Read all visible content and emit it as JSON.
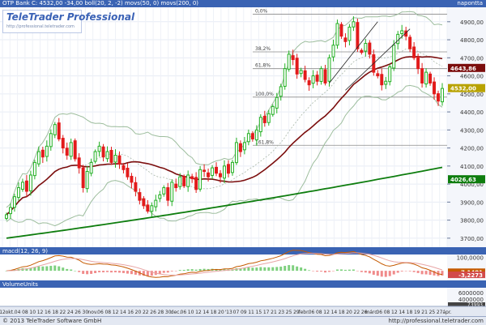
{
  "header": {
    "instrument": "OTP Bank C: 4532,00 -34,00 boll(20, 2, -2) movs(50, 0) movs(200, 0)",
    "timeframe": "napontta"
  },
  "logo": {
    "title": "TeleTrader Professional",
    "url": "http://professional.teletrader.com"
  },
  "macd_panel": {
    "title": "macd(12, 26, 9)"
  },
  "volume_panel": {
    "title": "VolumeUnits"
  },
  "footer": {
    "copyright": "© 2013 TeleTrader Software GmbH",
    "site": "http://professional.teletrader.com"
  },
  "colors": {
    "header_bg": "#3a63b3",
    "up_candle": "#22b022",
    "down_candle": "#e21b1b",
    "bollinger": "#9dbd9d",
    "ma50": "#7b0d0d",
    "ma200": "#0e7d0e",
    "macd_line": "#c55a00",
    "macd_signal": "#e8a5a5",
    "hist_pos": "#7fd07f",
    "hist_neg": "#f08a8a"
  },
  "chart_data": [
    {
      "type": "line",
      "title": "OTP Bank",
      "y_ticks": [
        "4900,00",
        "4800,00",
        "4700,00",
        "4600,00",
        "4500,00",
        "4400,00",
        "4300,00",
        "4200,00",
        "4100,00",
        "4000,00",
        "3900,00",
        "3800,00",
        "3700,00"
      ],
      "ylim": [
        3650,
        4980
      ],
      "x_ticks": [
        "12",
        "okt.",
        "04",
        "08",
        "10",
        "12",
        "16",
        "18",
        "22",
        "24",
        "26",
        "30",
        "nov.",
        "06",
        "08",
        "12",
        "14",
        "16",
        "20",
        "22",
        "26",
        "28",
        "30",
        "dec.",
        "06",
        "10",
        "12",
        "14",
        "18",
        "20",
        "'13",
        "07",
        "09",
        "11",
        "15",
        "17",
        "21",
        "23",
        "25",
        "29",
        "febr.",
        "06",
        "08",
        "12",
        "14",
        "18",
        "20",
        "22",
        "26",
        "márc.",
        "06",
        "08",
        "12",
        "14",
        "18",
        "19",
        "21",
        "25",
        "27",
        "ápr."
      ],
      "price_close": [
        3830,
        3870,
        3930,
        3980,
        4010,
        3960,
        4050,
        4120,
        4180,
        4150,
        4210,
        4280,
        4330,
        4250,
        4200,
        4160,
        4230,
        4140,
        4090,
        3980,
        4070,
        4120,
        4180,
        4210,
        4150,
        4180,
        4120,
        4160,
        4110,
        4080,
        4040,
        4010,
        3960,
        3910,
        3880,
        3850,
        3880,
        3910,
        3940,
        3980,
        3910,
        4010,
        3980,
        4040,
        3990,
        4050,
        4030,
        3970,
        4080,
        4070,
        4040,
        4090,
        4060,
        4040,
        4100,
        4060,
        4120,
        4230,
        4180,
        4230,
        4280,
        4250,
        4300,
        4370,
        4340,
        4390,
        4430,
        4480,
        4540,
        4640,
        4720,
        4690,
        4610,
        4630,
        4580,
        4550,
        4600,
        4570,
        4640,
        4560,
        4700,
        4770,
        4890,
        4820,
        4790,
        4870,
        4900,
        4750,
        4730,
        4780,
        4720,
        4620,
        4600,
        4550,
        4570,
        4650,
        4770,
        4830,
        4850,
        4820,
        4750,
        4700,
        4640,
        4560,
        4620,
        4560,
        4500,
        4460,
        4530
      ],
      "reference_values": {
        "last_price": "4532,00",
        "ma50_value": "4643,86",
        "ma200_value": "4026,63"
      },
      "fibonacci": [
        {
          "label": "0,0%",
          "value": 4942
        },
        {
          "label": "38,2%",
          "value": 4733
        },
        {
          "label": "61,8%",
          "value": 4640
        },
        {
          "label": "100,0%",
          "value": 4482
        },
        {
          "label": "161,8%",
          "value": 4215
        }
      ],
      "series": [
        {
          "name": "boll(20, 2, -2)"
        },
        {
          "name": "movs(50, 0)"
        },
        {
          "name": "movs(200, 0)"
        }
      ]
    },
    {
      "type": "line",
      "title": "macd(12, 26, 9)",
      "y_ticks": [
        "100,0000",
        "0,0000"
      ],
      "reference_values": {
        "macd": "-7,1481",
        "signal": "-3,2273"
      }
    },
    {
      "type": "bar",
      "title": "VolumeUnits",
      "y_ticks": [
        "6000000",
        "4000000"
      ],
      "reference_values": {
        "volume": "73993"
      }
    }
  ]
}
